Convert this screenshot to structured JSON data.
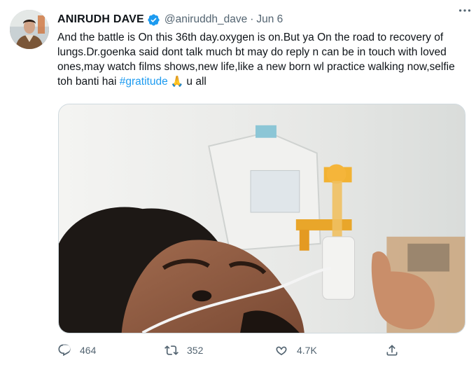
{
  "tweet": {
    "display_name": "ANIRUDH DAVE",
    "handle": "@aniruddh_dave",
    "separator": "·",
    "date": "Jun 6",
    "text_main": "And the battle is On this 36th day.oxygen is on.But ya On the road to recovery of lungs.Dr.goenka said dont talk much bt may do reply n can be in touch with loved ones,may watch films shows,new life,like a new born wl practice walking now,selfie toh banti hai ",
    "hashtag": "#gratitude",
    "emoji": "🙏",
    "text_tail": "u all",
    "more_label": "···"
  },
  "actions": {
    "reply_count": "464",
    "retweet_count": "352",
    "like_count": "4.7K"
  },
  "icons": {
    "verified": "verified-badge-icon",
    "reply": "reply-icon",
    "retweet": "retweet-icon",
    "like": "heart-icon",
    "share": "share-icon",
    "more": "more-icon"
  },
  "colors": {
    "accent": "#1d9bf0",
    "text": "#0f1419",
    "muted": "#536471"
  }
}
